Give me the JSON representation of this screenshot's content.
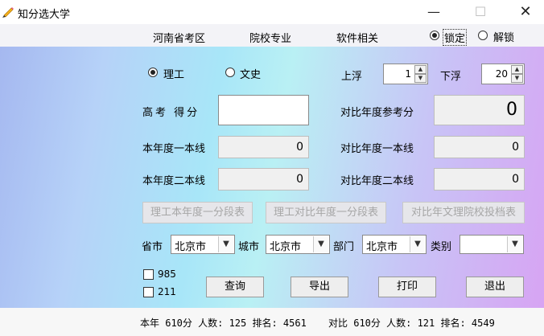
{
  "window": {
    "title": "知分选大学",
    "minimize": "—",
    "maximize": "☐",
    "close": "✕"
  },
  "menu": {
    "items": [
      "河南省考区",
      "院校专业",
      "软件相关"
    ],
    "lock_label": "锁定",
    "unlock_label": "解锁",
    "lock_selected": true
  },
  "subject": {
    "science": "理工",
    "arts": "文史",
    "selected": "science"
  },
  "float": {
    "up_label": "上浮",
    "up_value": "1",
    "down_label": "下浮",
    "down_value": "20"
  },
  "score": {
    "label": "高考 得分",
    "value": "",
    "ref_label": "对比年度参考分",
    "ref_value": "0"
  },
  "lines": {
    "cur_first_label": "本年度一本线",
    "cur_first_value": "0",
    "cmp_first_label": "对比年度一本线",
    "cmp_first_value": "0",
    "cur_second_label": "本年度二本线",
    "cur_second_value": "0",
    "cmp_second_label": "对比年度二本线",
    "cmp_second_value": "0"
  },
  "table_buttons": [
    "理工本年度一分段表",
    "理工对比年度一分段表",
    "对比年文理院校投档表"
  ],
  "filters": {
    "province_label": "省市",
    "province_value": "北京市",
    "city_label": "城市",
    "city_value": "北京市",
    "dept_label": "部门",
    "dept_value": "北京市",
    "category_label": "类别",
    "category_value": ""
  },
  "checks": {
    "c985": "985",
    "c211": "211"
  },
  "actions": {
    "query": "查询",
    "export": "导出",
    "print": "打印",
    "exit": "退出"
  },
  "status": {
    "current": "本年 610分 人数: 125 排名: 4561",
    "compare": "对比 610分 人数: 121 排名: 4549"
  },
  "icons": {
    "app": "pencil-icon",
    "dropdown": "chevron-down-icon",
    "spin_up": "arrow-up-icon",
    "spin_down": "arrow-down-icon"
  },
  "colors": {
    "accent": "#222222",
    "panel_left": "#a5b8f0",
    "panel_mid": "#a8e6f8",
    "panel_right": "#d7a4f3"
  }
}
